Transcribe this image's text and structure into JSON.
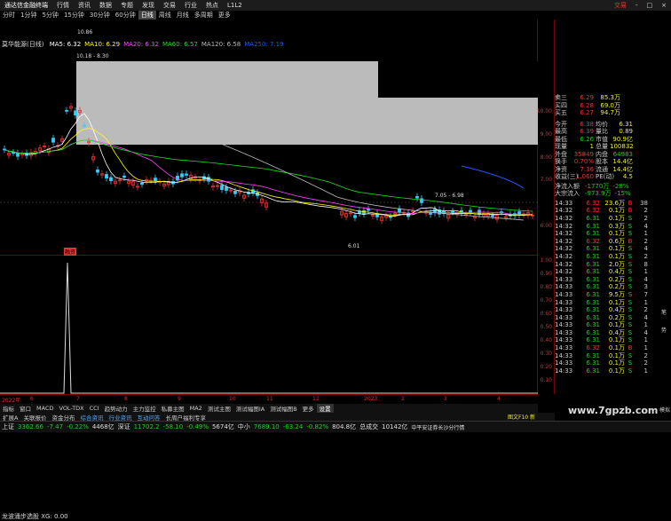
{
  "menubar": {
    "logo": "通达信金融终端",
    "items": [
      "行情",
      "资讯",
      "数据",
      "专题",
      "发现",
      "交易",
      "行业",
      "热点",
      "L1L2"
    ],
    "right": "交易",
    "window_controls": [
      "-",
      "□",
      "×"
    ]
  },
  "periods": [
    "分时",
    "1分钟",
    "5分钟",
    "15分钟",
    "30分钟",
    "60分钟",
    "日线",
    "周线",
    "月线",
    "多周期",
    "更多"
  ],
  "active_period": "日线",
  "stock_title": "莫华能源(日线)",
  "ma": [
    {
      "label": "MA5: 6.32",
      "color": "#ffffff"
    },
    {
      "label": "MA10: 6.29",
      "color": "#ffff00"
    },
    {
      "label": "MA20: 6.32",
      "color": "#ff44ff"
    },
    {
      "label": "MA60: 6.57",
      "color": "#22dd22"
    },
    {
      "label": "MA120: 6.58",
      "color": "#bbbbbb"
    },
    {
      "label": "MA250: 7.19",
      "color": "#2255ff"
    }
  ],
  "annotations": {
    "high": "10.86",
    "range": "10.18 - 8.30",
    "mid": "7.05 - 6.98",
    "low": "6.01",
    "tag": "融资"
  },
  "price_ticks": [
    "10.00",
    "9.00",
    "8.00",
    "7.00",
    "6.00"
  ],
  "indicator_title": "龙波涌步选股  XG: 0.00",
  "indicator_ticks": [
    "1.00",
    "0.90",
    "0.80",
    "0.70",
    "0.60",
    "0.50",
    "0.40",
    "0.30",
    "0.20",
    "0.10"
  ],
  "dates": [
    "2022年",
    "6",
    "7",
    "8",
    "9",
    "10",
    "11",
    "12",
    "2023",
    "2",
    "3",
    "4"
  ],
  "tabs": [
    "指标",
    "窗口",
    "MACD",
    "VOL-TDX",
    "CCI",
    "趋势动力",
    "主力监控",
    "私募主图",
    "MA2",
    "测试主图",
    "测试幅图IA",
    "测试幅图B",
    "更多",
    "设置"
  ],
  "tabs2": [
    "扩展A",
    "关联报价",
    "资金分布",
    "综合资讯",
    "行业资讯",
    "互动问答",
    "长周户福利专享"
  ],
  "quotes": [
    {
      "label": "卖三",
      "price": "6.29",
      "vol": "85.3万"
    },
    {
      "label": "买四",
      "price": "6.28",
      "vol": "69.0万"
    },
    {
      "label": "买五",
      "price": "6.27",
      "vol": "94.7万"
    }
  ],
  "stats": [
    {
      "k1": "今开",
      "v1": "6.38",
      "k2": "均价",
      "v2": "6.31"
    },
    {
      "k1": "最高",
      "v1": "6.39",
      "k2": "量比",
      "v2": "0.89"
    },
    {
      "k1": "最低",
      "v1": "6.26",
      "k2": "市值",
      "v2": "90.9亿"
    },
    {
      "k1": "现量",
      "v1": "1",
      "k2": "总量",
      "v2": "100832"
    },
    {
      "k1": "外盘",
      "v1": "35849",
      "k2": "内盘",
      "v2": "64983"
    },
    {
      "k1": "换手",
      "v1": "0.70%",
      "k2": "股本",
      "v2": "14.4亿"
    },
    {
      "k1": "净资",
      "v1": "7.36",
      "k2": "流通",
      "v2": "14.4亿"
    },
    {
      "k1": "收益(三)",
      "v1": "1.060",
      "k2": "PE(动)",
      "v2": "4.5"
    }
  ],
  "flows": [
    {
      "label": "净流入额",
      "value": "-1770万",
      "pct": "-28%"
    },
    {
      "label": "大宗流入",
      "value": "-973.9万",
      "pct": "-15%"
    }
  ],
  "ticks": [
    {
      "time": "14:33",
      "price": "6.32",
      "vol": "23.6万",
      "dir": "B",
      "n": "38"
    },
    {
      "time": "14:32",
      "price": "6.32",
      "vol": "0.1万",
      "dir": "B",
      "n": "2"
    },
    {
      "time": "14:32",
      "price": "6.31",
      "vol": "0.1万",
      "dir": "S",
      "n": "2"
    },
    {
      "time": "14:32",
      "price": "6.31",
      "vol": "0.3万",
      "dir": "S",
      "n": "4"
    },
    {
      "time": "14:32",
      "price": "6.31",
      "vol": "0.1万",
      "dir": "S",
      "n": "1"
    },
    {
      "time": "14:32",
      "price": "6.32",
      "vol": "0.6万",
      "dir": "B",
      "n": "2"
    },
    {
      "time": "14:32",
      "price": "6.31",
      "vol": "0.1万",
      "dir": "S",
      "n": "4"
    },
    {
      "time": "14:32",
      "price": "6.31",
      "vol": "0.1万",
      "dir": "S",
      "n": "2"
    },
    {
      "time": "14:32",
      "price": "6.31",
      "vol": "2.0万",
      "dir": "S",
      "n": "8"
    },
    {
      "time": "14:32",
      "price": "6.31",
      "vol": "0.4万",
      "dir": "S",
      "n": "1"
    },
    {
      "time": "14:33",
      "price": "6.31",
      "vol": "0.2万",
      "dir": "S",
      "n": "4"
    },
    {
      "time": "14:33",
      "price": "6.31",
      "vol": "0.2万",
      "dir": "S",
      "n": "3"
    },
    {
      "time": "14:33",
      "price": "6.31",
      "vol": "9.5万",
      "dir": "S",
      "n": "7"
    },
    {
      "time": "14:33",
      "price": "6.31",
      "vol": "0.1万",
      "dir": "S",
      "n": "1"
    },
    {
      "time": "14:33",
      "price": "6.31",
      "vol": "0.4万",
      "dir": "S",
      "n": "2"
    },
    {
      "time": "14:33",
      "price": "6.31",
      "vol": "0.2万",
      "dir": "S",
      "n": "4"
    },
    {
      "time": "14:33",
      "price": "6.31",
      "vol": "0.1万",
      "dir": "S",
      "n": "1"
    },
    {
      "time": "14:33",
      "price": "6.31",
      "vol": "0.4万",
      "dir": "S",
      "n": "4"
    },
    {
      "time": "14:33",
      "price": "6.31",
      "vol": "0.1万",
      "dir": "S",
      "n": "1"
    },
    {
      "time": "14:33",
      "price": "6.32",
      "vol": "0.1万",
      "dir": "B",
      "n": "1"
    },
    {
      "time": "14:33",
      "price": "6.31",
      "vol": "0.1万",
      "dir": "S",
      "n": "2"
    },
    {
      "time": "14:33",
      "price": "6.31",
      "vol": "0.1万",
      "dir": "S",
      "n": "2"
    },
    {
      "time": "14:33",
      "price": "6.31",
      "vol": "0.1万",
      "dir": "S",
      "n": "1"
    }
  ],
  "side_buttons": [
    "模拟",
    "笔",
    "势"
  ],
  "status": {
    "sh_label": "上证",
    "sh": "3362.66",
    "sh_chg": "-7.47",
    "sh_pct": "-0.22%",
    "sh_amt": "4468亿",
    "sz_label": "深证",
    "sz": "11702.2",
    "sz_chg": "-58.10",
    "sz_pct": "-0.49%",
    "sz_amt": "5674亿",
    "zx_label": "中小",
    "zx": "7689.10",
    "zx_chg": "-63.24",
    "zx_pct": "-0.82%",
    "zx_amt": "804.8亿",
    "total_label": "总成交",
    "total": "10142亿",
    "news": "中平安证券长沙分行情"
  },
  "watermark": "www.7gpzb.com",
  "status_right": "图文F10 新"
}
